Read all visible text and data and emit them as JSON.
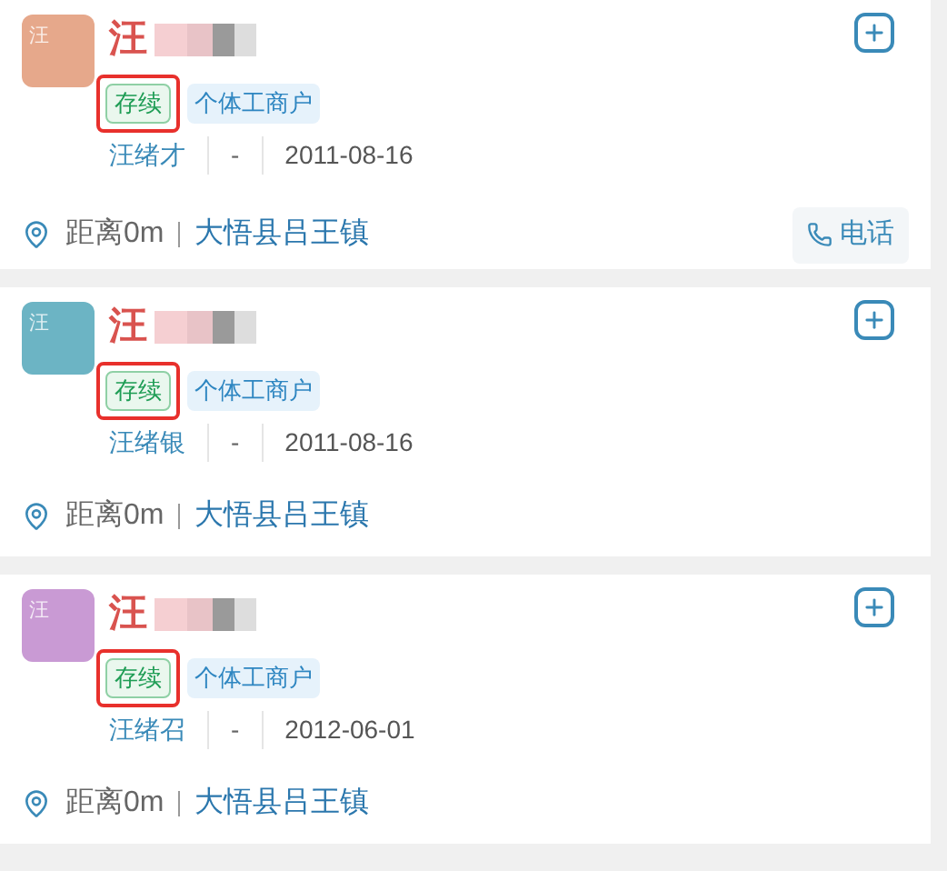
{
  "companies": [
    {
      "avatar": {
        "text": "汪",
        "color": "#e6a88b"
      },
      "name": "汪",
      "status": {
        "label": "存续",
        "highlighted": true
      },
      "type": "个体工商户",
      "person": "汪绪才",
      "separator": "-",
      "date": "2011-08-16",
      "distance": "距离0m",
      "region": "大悟县吕王镇",
      "phone": "电话"
    },
    {
      "avatar": {
        "text": "汪",
        "color": "#6cb4c4"
      },
      "name": "汪",
      "status": {
        "label": "存续",
        "highlighted": true
      },
      "type": "个体工商户",
      "person": "汪绪银",
      "separator": "-",
      "date": "2011-08-16",
      "distance": "距离0m",
      "region": "大悟县吕王镇"
    },
    {
      "avatar": {
        "text": "汪",
        "color": "#c99ad4"
      },
      "name": "汪",
      "status": {
        "label": "存续",
        "highlighted": true
      },
      "type": "个体工商户",
      "person": "汪绪召",
      "separator": "-",
      "date": "2012-06-01",
      "distance": "距离0m",
      "region": "大悟县吕王镇"
    }
  ]
}
